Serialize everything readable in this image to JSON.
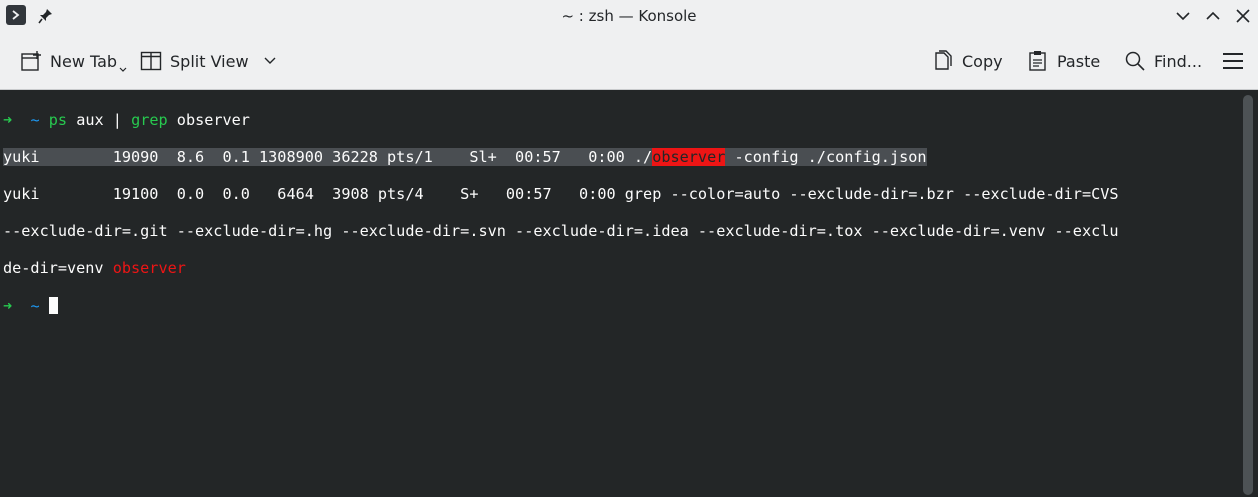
{
  "window": {
    "title": "~ : zsh — Konsole"
  },
  "toolbar": {
    "new_tab": "New Tab",
    "split_view": "Split View",
    "copy": "Copy",
    "paste": "Paste",
    "find": "Find..."
  },
  "terminal": {
    "prompt_arrow": "➜",
    "prompt_dir": "~",
    "command_ps": "ps",
    "command_args": " aux | ",
    "command_grep": "grep",
    "command_tail": " observer",
    "row1_pre": "yuki        19090  8.6  0.1 1308900 36228 pts/1    Sl+  00:57   0:00 ./",
    "row1_match": "observer",
    "row1_post": " -config ./config.json",
    "row2": "yuki        19100  0.0  0.0   6464  3908 pts/4    S+   00:57   0:00 grep --color=auto --exclude-dir=.bzr --exclude-dir=CVS",
    "row3": "--exclude-dir=.git --exclude-dir=.hg --exclude-dir=.svn --exclude-dir=.idea --exclude-dir=.tox --exclude-dir=.venv --exclu",
    "row4_pre": "de-dir=venv ",
    "row4_match": "observer"
  },
  "colors": {
    "prompt_green": "#27c94f",
    "prompt_blue": "#1d99f3",
    "match_red": "#ed1515",
    "background": "#232627"
  }
}
